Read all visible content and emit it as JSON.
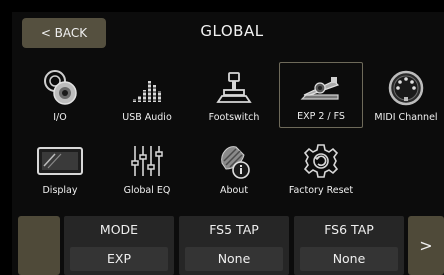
{
  "header": {
    "back_label": "< BACK",
    "title": "GLOBAL"
  },
  "tiles": [
    {
      "label": "I/O",
      "icon": "io-jack-icon"
    },
    {
      "label": "USB Audio",
      "icon": "usb-audio-meter-icon"
    },
    {
      "label": "Footswitch",
      "icon": "footswitch-icon"
    },
    {
      "label": "EXP 2 / FS",
      "icon": "expression-pedal-icon",
      "selected": true
    },
    {
      "label": "MIDI Channel",
      "icon": "midi-connector-icon"
    },
    {
      "label": "Display",
      "icon": "display-icon"
    },
    {
      "label": "Global EQ",
      "icon": "eq-sliders-icon"
    },
    {
      "label": "About",
      "icon": "about-info-icon"
    },
    {
      "label": "Factory Reset",
      "icon": "factory-reset-icon"
    }
  ],
  "params": [
    {
      "name": "MODE",
      "value": "EXP"
    },
    {
      "name": "FS5 TAP",
      "value": "None"
    },
    {
      "name": "FS6 TAP",
      "value": "None"
    }
  ],
  "nav": {
    "next_label": ">"
  },
  "colors": {
    "background": "#0c0c0c",
    "button": "#55503f",
    "param_box": "#262626",
    "selected_border": "#6e6a5a"
  }
}
